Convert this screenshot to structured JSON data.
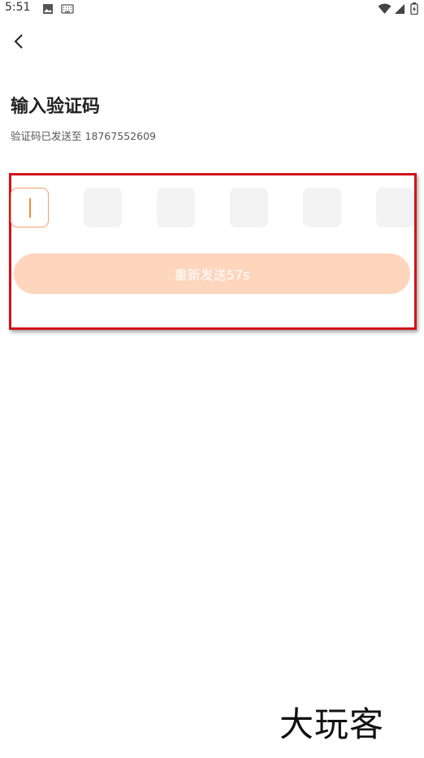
{
  "status_bar": {
    "time": "5:51",
    "icons": [
      "image-icon",
      "keyboard-icon",
      "wifi-icon",
      "signal-icon",
      "battery-icon"
    ]
  },
  "header": {
    "back_icon": "chevron-left-icon"
  },
  "main": {
    "title": "输入验证码",
    "subtitle_prefix": "验证码已发送至",
    "phone": "18767552609",
    "code_cells": [
      "",
      "",
      "",
      "",
      "",
      ""
    ],
    "resend_label": "重新发送57s"
  },
  "watermark": {
    "text": "大玩客"
  },
  "colors": {
    "accent": "#f08a3c",
    "button_bg": "#fed5bd",
    "cell_bg": "#f3f3f3",
    "highlight": "#d0121b"
  }
}
